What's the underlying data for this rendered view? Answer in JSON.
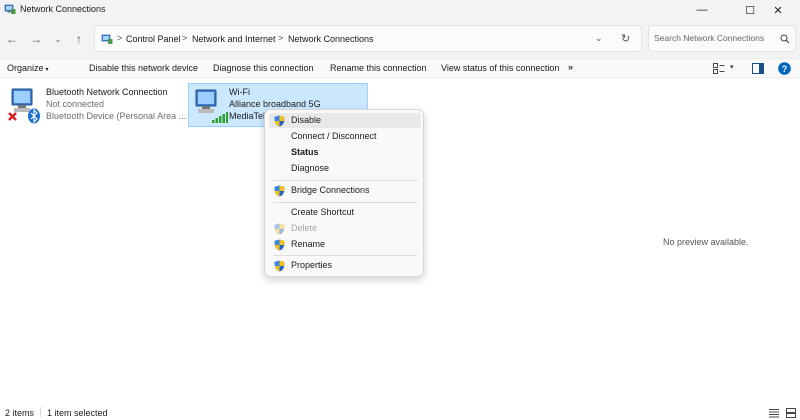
{
  "window": {
    "title": "Network Connections",
    "icon": "network-folder-icon",
    "controls": {
      "minimize": "—",
      "maximize": "☐",
      "close": "✕"
    }
  },
  "address_bar": {
    "nav": {
      "back": "←",
      "forward": "→",
      "recent": "⌄",
      "up": "↑"
    },
    "sep_glyph": ">",
    "breadcrumbs": [
      "Control Panel",
      "Network and Internet",
      "Network Connections"
    ],
    "dropdown_glyph": "⌄",
    "refresh_glyph": "↻"
  },
  "search": {
    "placeholder": "Search Network Connections"
  },
  "command_bar": {
    "organize": "Organize",
    "organize_caret": "▾",
    "items": [
      "Disable this network device",
      "Diagnose this connection",
      "Rename this connection",
      "View status of this connection"
    ],
    "more": "»",
    "view_caret": "▾"
  },
  "connections": [
    {
      "name": "Bluetooth Network Connection",
      "status": "Not connected",
      "device": "Bluetooth Device (Personal Area ...",
      "icon": "bluetooth-adapter-icon",
      "selected": false
    },
    {
      "name": "Wi-Fi",
      "status": "Alliance broadband 5G",
      "device": "MediaTek",
      "icon": "wifi-adapter-icon",
      "selected": true
    }
  ],
  "preview_text": "No preview available.",
  "context_menu": {
    "items": [
      {
        "label": "Disable",
        "shield": true,
        "bold": false,
        "disabled": false,
        "hover": true
      },
      {
        "label": "Connect / Disconnect",
        "shield": false,
        "bold": false,
        "disabled": false
      },
      {
        "label": "Status",
        "shield": false,
        "bold": true,
        "disabled": false
      },
      {
        "label": "Diagnose",
        "shield": false,
        "bold": false,
        "disabled": false
      },
      {
        "label": "Bridge Connections",
        "shield": true,
        "bold": false,
        "disabled": false
      },
      {
        "label": "Create Shortcut",
        "shield": false,
        "bold": false,
        "disabled": false
      },
      {
        "label": "Delete",
        "shield": true,
        "bold": false,
        "disabled": true
      },
      {
        "label": "Rename",
        "shield": true,
        "bold": false,
        "disabled": false
      },
      {
        "label": "Properties",
        "shield": true,
        "bold": false,
        "disabled": false
      }
    ]
  },
  "status_bar": {
    "item_count": "2 items",
    "selection": "1 item selected"
  },
  "colors": {
    "selection_bg": "#cce8ff",
    "selection_border": "#99d1ff",
    "accent": "#0067c0"
  }
}
